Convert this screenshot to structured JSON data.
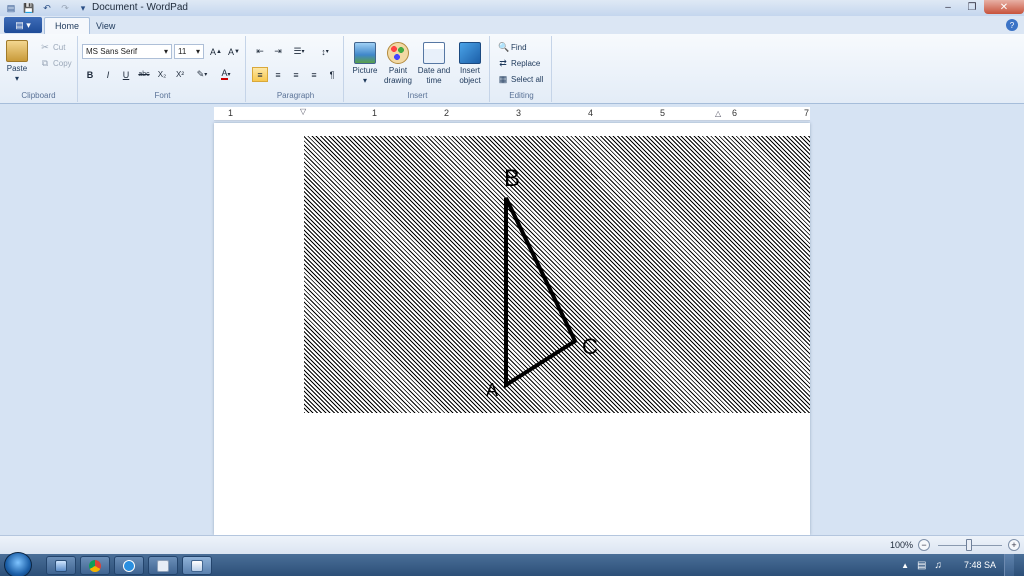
{
  "window": {
    "title": "Document - WordPad",
    "controls": [
      "minimize",
      "maximize",
      "close"
    ]
  },
  "quick_access": {
    "items": [
      "save-icon",
      "undo-icon",
      "redo-icon",
      "customize-icon"
    ]
  },
  "tabs": [
    {
      "label": "Home",
      "active": true
    },
    {
      "label": "View",
      "active": false
    }
  ],
  "ribbon": {
    "clipboard": {
      "label": "Clipboard",
      "paste": "Paste",
      "cut": "Cut",
      "copy": "Copy"
    },
    "font": {
      "label": "Font",
      "family": "MS Sans Serif",
      "size": "11",
      "buttons": [
        "B",
        "I",
        "U",
        "abc",
        "X₂",
        "X²"
      ]
    },
    "paragraph": {
      "label": "Paragraph"
    },
    "insert": {
      "label": "Insert",
      "picture": "Picture",
      "paint": "Paint drawing",
      "datetime": "Date and time",
      "object": "Insert object"
    },
    "editing": {
      "label": "Editing",
      "find": "Find",
      "replace": "Replace",
      "select_all": "Select all"
    }
  },
  "ruler": {
    "numbers": [
      "1",
      "1",
      "2",
      "3",
      "4",
      "5",
      "6",
      "7"
    ]
  },
  "drawing": {
    "labels": [
      "B",
      "C",
      "A"
    ]
  },
  "status": {
    "zoom": "100%"
  },
  "taskbar": {
    "apps": [
      "computer-icon",
      "chrome-icon",
      "messenger-icon",
      "notes-icon",
      "wordpad-icon"
    ],
    "clock": "7:48 SA"
  },
  "colors": {
    "accent": "#1e4c98",
    "ribbon_bg": "#e3ecf7",
    "doc_bg": "#d6e3f3",
    "taskbar": "#2c4f78"
  }
}
